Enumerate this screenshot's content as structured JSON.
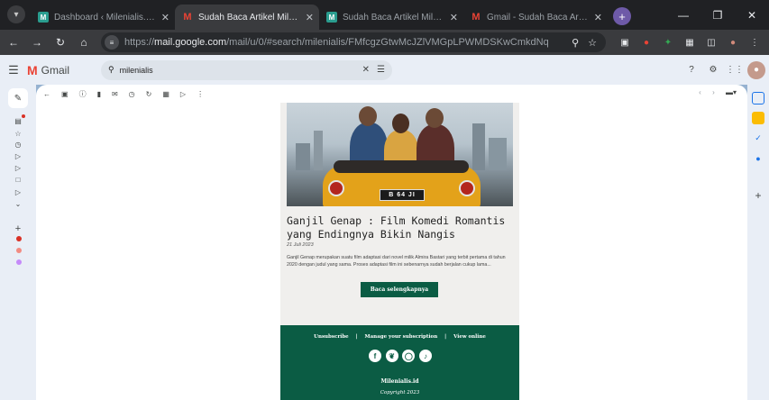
{
  "browser": {
    "tabs": [
      {
        "title": "Dashboard ‹ Milenialis.id — W…",
        "favicon": "M",
        "active": false
      },
      {
        "title": "Sudah Baca Artikel Milenialis.id",
        "favicon": "gmail",
        "active": true
      },
      {
        "title": "Sudah Baca Artikel Milenialis.id",
        "favicon": "M",
        "active": false
      },
      {
        "title": "Gmail - Sudah Baca Artikel Mil…",
        "favicon": "gmail",
        "active": false
      }
    ],
    "new_tab_label": "+",
    "url_prefix": "https://",
    "url_host": "mail.google.com",
    "url_path": "/mail/u/0/#search/milenialis/FMfcgzGtwMcJZlVMGpLPWMDSKwCmkdNq"
  },
  "gmail": {
    "brand": "Gmail",
    "search_value": "milenialis"
  },
  "email": {
    "article_title": "Ganjil Genap : Film Komedi Romantis yang Endingnya Bikin Nangis",
    "article_date": "21 Juli 2023",
    "article_desc": "Ganjil Genap merupakan suatu film adaptasi dari novel milik Almira Bastari  yang terbit pertama di tahun 2020 dengan judul yang sama. Proses adaptasi film ini sebenarnya sudah berjalan cukup lama...",
    "read_more": "Baca selengkapnya",
    "plate": "B 64 JI",
    "footer_unsubscribe": "Unsubscribe",
    "footer_separator": "|",
    "footer_manage": "Manage your subscription",
    "footer_view": "View online",
    "brand": "Milenialis.id",
    "copyright": "Copyright 2023"
  },
  "colors": {
    "footer_green": "#0b5c44",
    "gmail_red": "#ea4335",
    "chrome_dark": "#202124"
  }
}
